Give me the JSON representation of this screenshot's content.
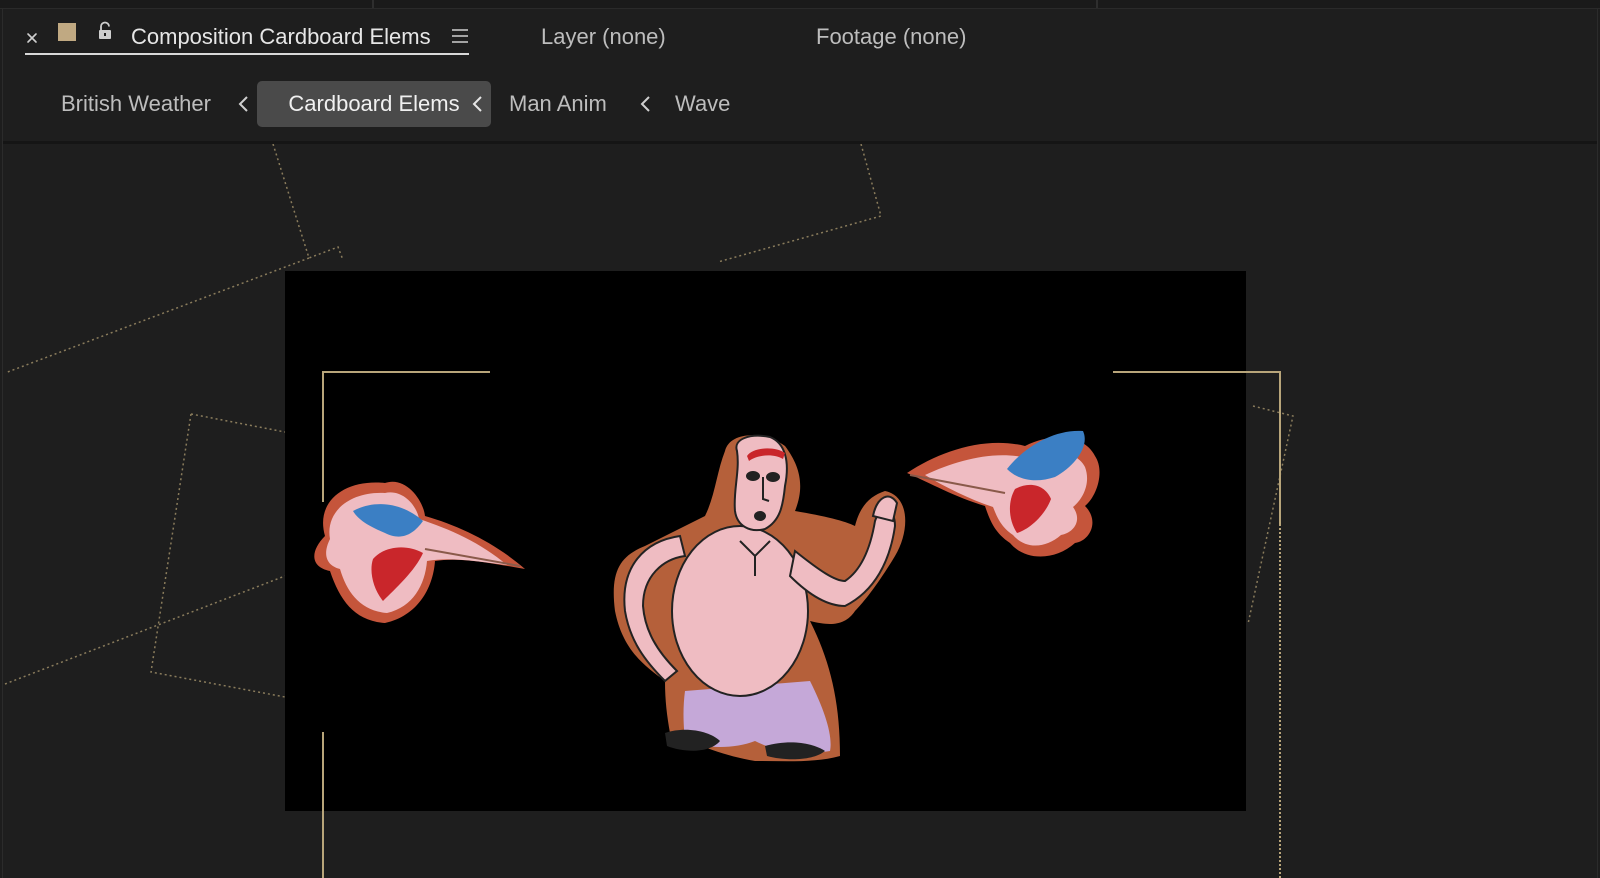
{
  "panel": {
    "composition_tab_label": "Composition Cardboard Elems",
    "layer_tab_label": "Layer (none)",
    "footage_tab_label": "Footage (none)",
    "label_color": "#c0a982"
  },
  "breadcrumbs": [
    {
      "label": "British Weather",
      "active": false
    },
    {
      "label": "Cardboard Elems",
      "active": true
    },
    {
      "label": "Man Anim",
      "active": false
    },
    {
      "label": "Wave",
      "active": false
    }
  ],
  "viewer": {
    "canvas_color": "#000000",
    "guide_color": "#b8a57a"
  }
}
